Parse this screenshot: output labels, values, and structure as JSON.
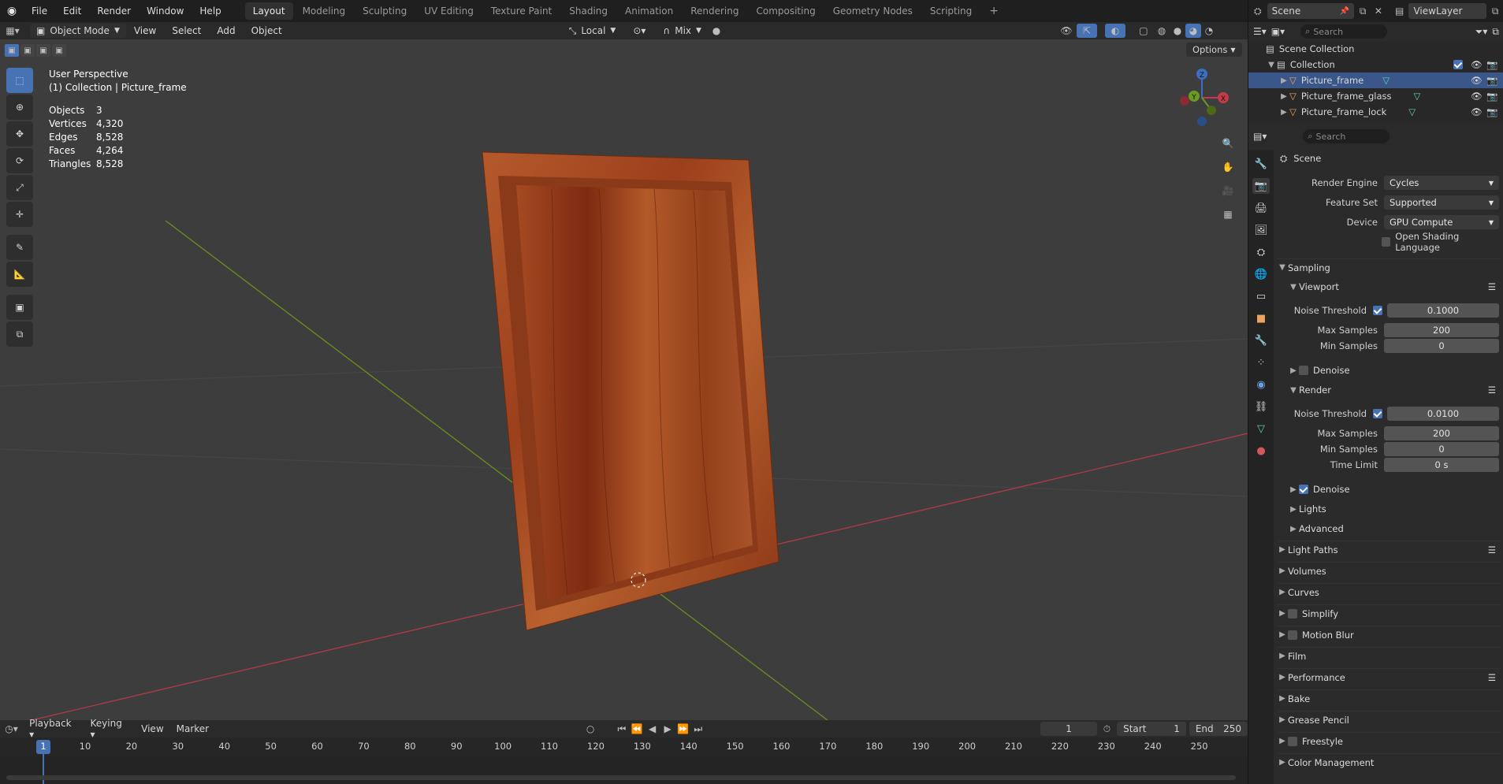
{
  "topbar": {
    "menus": [
      "File",
      "Edit",
      "Render",
      "Window",
      "Help"
    ],
    "workspaces": [
      "Layout",
      "Modeling",
      "Sculpting",
      "UV Editing",
      "Texture Paint",
      "Shading",
      "Animation",
      "Rendering",
      "Compositing",
      "Geometry Nodes",
      "Scripting"
    ],
    "add_tab": "+",
    "scene_label": "Scene",
    "viewlayer_label": "ViewLayer"
  },
  "viewport_header": {
    "mode": "Object Mode",
    "menus": [
      "View",
      "Select",
      "Add",
      "Object"
    ],
    "orientation": "Local",
    "snap_mode": "Mix",
    "options": "Options"
  },
  "viewport": {
    "perspective_label": "User Perspective",
    "collection_label": "(1) Collection | Picture_frame",
    "stats": [
      {
        "label": "Objects",
        "value": "3"
      },
      {
        "label": "Vertices",
        "value": "4,320"
      },
      {
        "label": "Edges",
        "value": "8,528"
      },
      {
        "label": "Faces",
        "value": "4,264"
      },
      {
        "label": "Triangles",
        "value": "8,528"
      }
    ],
    "gizmo_axes": [
      "X",
      "Y",
      "Z"
    ]
  },
  "outliner": {
    "search_placeholder": "Search",
    "scene_collection": "Scene Collection",
    "collection": "Collection",
    "objects": [
      "Picture_frame",
      "Picture_frame_glass",
      "Picture_frame_lock"
    ]
  },
  "properties": {
    "search_placeholder": "Search",
    "context": "Scene",
    "render_engine_label": "Render Engine",
    "render_engine": "Cycles",
    "feature_set_label": "Feature Set",
    "feature_set": "Supported",
    "device_label": "Device",
    "device": "GPU Compute",
    "osl_label": "Open Shading Language",
    "sampling": "Sampling",
    "viewport_section": "Viewport",
    "noise_threshold_label": "Noise Threshold",
    "viewport_noise_threshold": "0.1000",
    "max_samples_label": "Max Samples",
    "viewport_max_samples": "200",
    "min_samples_label": "Min Samples",
    "viewport_min_samples": "0",
    "denoise_label": "Denoise",
    "render_section": "Render",
    "render_noise_threshold": "0.0100",
    "render_max_samples": "200",
    "render_min_samples": "0",
    "time_limit_label": "Time Limit",
    "time_limit": "0 s",
    "lights": "Lights",
    "advanced": "Advanced",
    "panels": [
      "Light Paths",
      "Volumes",
      "Curves",
      "Simplify",
      "Motion Blur",
      "Film",
      "Performance",
      "Bake",
      "Grease Pencil",
      "Freestyle",
      "Color Management"
    ]
  },
  "timeline": {
    "menus": [
      "Playback",
      "Keying",
      "View",
      "Marker"
    ],
    "current_frame": "1",
    "start_label": "Start",
    "start": "1",
    "end_label": "End",
    "end": "250",
    "ruler": [
      "1",
      "10",
      "20",
      "30",
      "40",
      "50",
      "60",
      "70",
      "80",
      "90",
      "100",
      "110",
      "120",
      "130",
      "140",
      "150",
      "160",
      "170",
      "180",
      "190",
      "200",
      "210",
      "220",
      "230",
      "240",
      "250"
    ]
  },
  "colors": {
    "accent": "#4772b3",
    "selected_row": "#3b5689",
    "viewport_bg": "#3d3d3d",
    "x_axis": "#b13b45",
    "y_axis": "#6a8f1f",
    "wood": "#a94a22"
  }
}
